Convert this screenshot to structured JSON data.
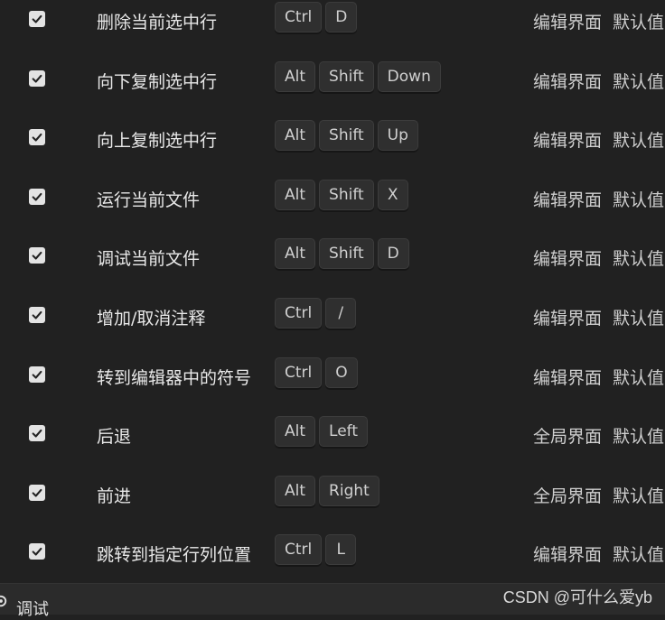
{
  "shortcuts": [
    {
      "enabled": true,
      "command": "删除当前选中行",
      "keys": [
        "Ctrl",
        "D"
      ],
      "scope": "编辑界面",
      "source": "默认值"
    },
    {
      "enabled": true,
      "command": "向下复制选中行",
      "keys": [
        "Alt",
        "Shift",
        "Down"
      ],
      "scope": "编辑界面",
      "source": "默认值"
    },
    {
      "enabled": true,
      "command": "向上复制选中行",
      "keys": [
        "Alt",
        "Shift",
        "Up"
      ],
      "scope": "编辑界面",
      "source": "默认值"
    },
    {
      "enabled": true,
      "command": "运行当前文件",
      "keys": [
        "Alt",
        "Shift",
        "X"
      ],
      "scope": "编辑界面",
      "source": "默认值"
    },
    {
      "enabled": true,
      "command": "调试当前文件",
      "keys": [
        "Alt",
        "Shift",
        "D"
      ],
      "scope": "编辑界面",
      "source": "默认值"
    },
    {
      "enabled": true,
      "command": "增加/取消注释",
      "keys": [
        "Ctrl",
        "/"
      ],
      "scope": "编辑界面",
      "source": "默认值"
    },
    {
      "enabled": true,
      "command": "转到编辑器中的符号",
      "keys": [
        "Ctrl",
        "O"
      ],
      "scope": "编辑界面",
      "source": "默认值"
    },
    {
      "enabled": true,
      "command": "后退",
      "keys": [
        "Alt",
        "Left"
      ],
      "scope": "全局界面",
      "source": "默认值"
    },
    {
      "enabled": true,
      "command": "前进",
      "keys": [
        "Alt",
        "Right"
      ],
      "scope": "全局界面",
      "source": "默认值"
    },
    {
      "enabled": true,
      "command": "跳转到指定行列位置",
      "keys": [
        "Ctrl",
        "L"
      ],
      "scope": "编辑界面",
      "source": "默认值"
    }
  ],
  "footer": {
    "section_label": "调试",
    "section_icon": "gear-icon",
    "watermark": "CSDN @可什么爱yb"
  },
  "colors": {
    "background": "#212121",
    "key_background": "#2f2f2f",
    "checkbox": "#e3e3e3"
  }
}
